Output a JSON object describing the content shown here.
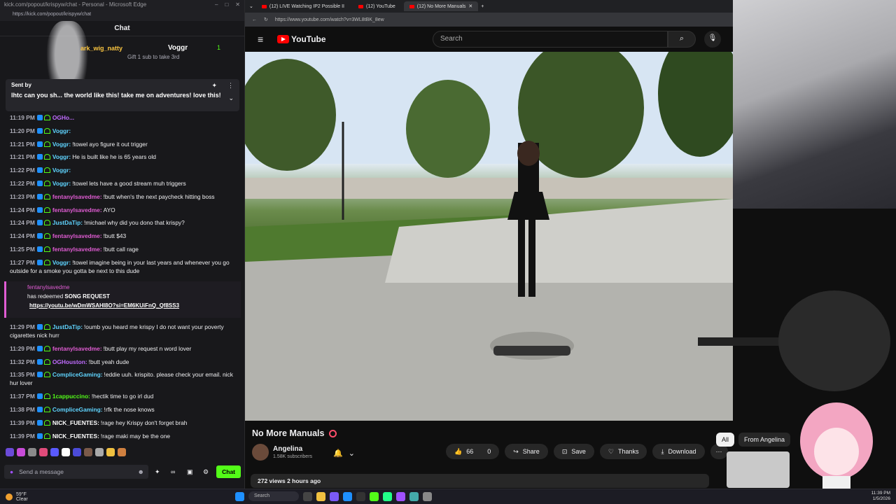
{
  "chat_window": {
    "title": "kick.com/popout/krispyw/chat - Personal - Microsoft Edge",
    "url": "https://kick.com/popout/krispyw/chat",
    "header": "Chat",
    "top_gifter": {
      "name": "ark_wig_natty",
      "rank_name": "Voggr",
      "count": "1",
      "subtext": "Gift 1 sub to take 3rd"
    },
    "pinned": {
      "sent_by": "Sent by",
      "message": "lhtc can you sh... the world like this! take me on adventures! love this!"
    },
    "messages": [
      {
        "time": "11:19 PM",
        "user": "OGHo...",
        "cls": "u-og",
        "text": ""
      },
      {
        "time": "11:20 PM",
        "user": "Voggr:",
        "cls": "u-voggr",
        "text": ""
      },
      {
        "time": "11:21 PM",
        "user": "Voggr:",
        "cls": "u-voggr",
        "text": "!towel ayo figure it out trigger"
      },
      {
        "time": "11:21 PM",
        "user": "Voggr:",
        "cls": "u-voggr",
        "text": "He is built like he is 65 years old"
      },
      {
        "time": "11:22 PM",
        "user": "Voggr:",
        "cls": "u-voggr",
        "text": ""
      },
      {
        "time": "11:22 PM",
        "user": "Voggr:",
        "cls": "u-voggr",
        "text": "!towel lets have a good stream muh triggers"
      },
      {
        "time": "11:23 PM",
        "user": "fentanylsavedme:",
        "cls": "u-fent",
        "text": "!butt when's the next paycheck hitting boss"
      },
      {
        "time": "11:24 PM",
        "user": "fentanylsavedme:",
        "cls": "u-fent",
        "text": "AYO"
      },
      {
        "time": "11:24 PM",
        "user": "JustDaTip:",
        "cls": "u-just",
        "text": "!michael why did you dono that krispy?"
      },
      {
        "time": "11:24 PM",
        "user": "fentanylsavedme:",
        "cls": "u-fent",
        "text": "!butt $43"
      },
      {
        "time": "11:25 PM",
        "user": "fentanylsavedme:",
        "cls": "u-fent",
        "text": "!butt call rage"
      },
      {
        "time": "11:27 PM",
        "user": "Voggr:",
        "cls": "u-voggr",
        "text": "!towel imagine being in your last years and whenever you go outside for a smoke you gotta be next to this dude"
      }
    ],
    "redeem": {
      "user": "fentanylsavedme",
      "text_pre": "has redeemed",
      "reward": "SONG REQUEST",
      "link": "https://youtu.be/wDmWSAHI8O?si=EM6KUiFnQ_Qf8SS3"
    },
    "messages2": [
      {
        "time": "11:29 PM",
        "user": "JustDaTip:",
        "cls": "u-just",
        "text": "!oumb you heard me krispy I do not want your poverty cigarettes nick hurr"
      },
      {
        "time": "11:29 PM",
        "user": "fentanylsavedme:",
        "cls": "u-fent",
        "text": "!butt play my request n word lover"
      },
      {
        "time": "11:32 PM",
        "user": "OGHouston:",
        "cls": "u-og",
        "text": "!butt yeah dude"
      },
      {
        "time": "11:35 PM",
        "user": "CompliceGaming:",
        "cls": "u-comp",
        "text": "!eddie uuh. krispito. please check your email. nick hur lover"
      },
      {
        "time": "11:37 PM",
        "user": "1cappuccino:",
        "cls": "u-cap",
        "text": "!hectik time to go irl dud"
      },
      {
        "time": "11:38 PM",
        "user": "CompliceGaming:",
        "cls": "u-comp",
        "text": "!rfk the nose knows"
      },
      {
        "time": "11:39 PM",
        "user": "NICK_FUENTES:",
        "cls": "u-nick",
        "text": "!rage hey Krispy don't forget brah"
      },
      {
        "time": "11:39 PM",
        "user": "NICK_FUENTES:",
        "cls": "u-nick",
        "text": "!rage maki may be the one"
      }
    ],
    "input_placeholder": "Send a message",
    "chat_button": "Chat"
  },
  "browser": {
    "tabs": [
      {
        "label": "(12) LIVE Watching IP2 Possible II"
      },
      {
        "label": "(12) YouTube"
      },
      {
        "label": "(12) No More Manuals"
      }
    ],
    "url": "https://www.youtube.com/watch?v=3WL8tBK_8ew",
    "search_placeholder": "Search",
    "logo_text": "YouTube",
    "video_title": "No More Manuals",
    "channel_name": "Angelina",
    "subscribers": "1.58K subscribers",
    "likes": "66",
    "dislikes": "0",
    "share": "Share",
    "save": "Save",
    "thanks": "Thanks",
    "download": "Download",
    "views": "272 views",
    "age": "2 hours ago",
    "chips": [
      "All",
      "From Angelina"
    ]
  },
  "taskbar": {
    "temp": "59°F",
    "weather": "Clear",
    "search": "Search",
    "time": "11:39 PM",
    "date": "1/5/2026"
  }
}
